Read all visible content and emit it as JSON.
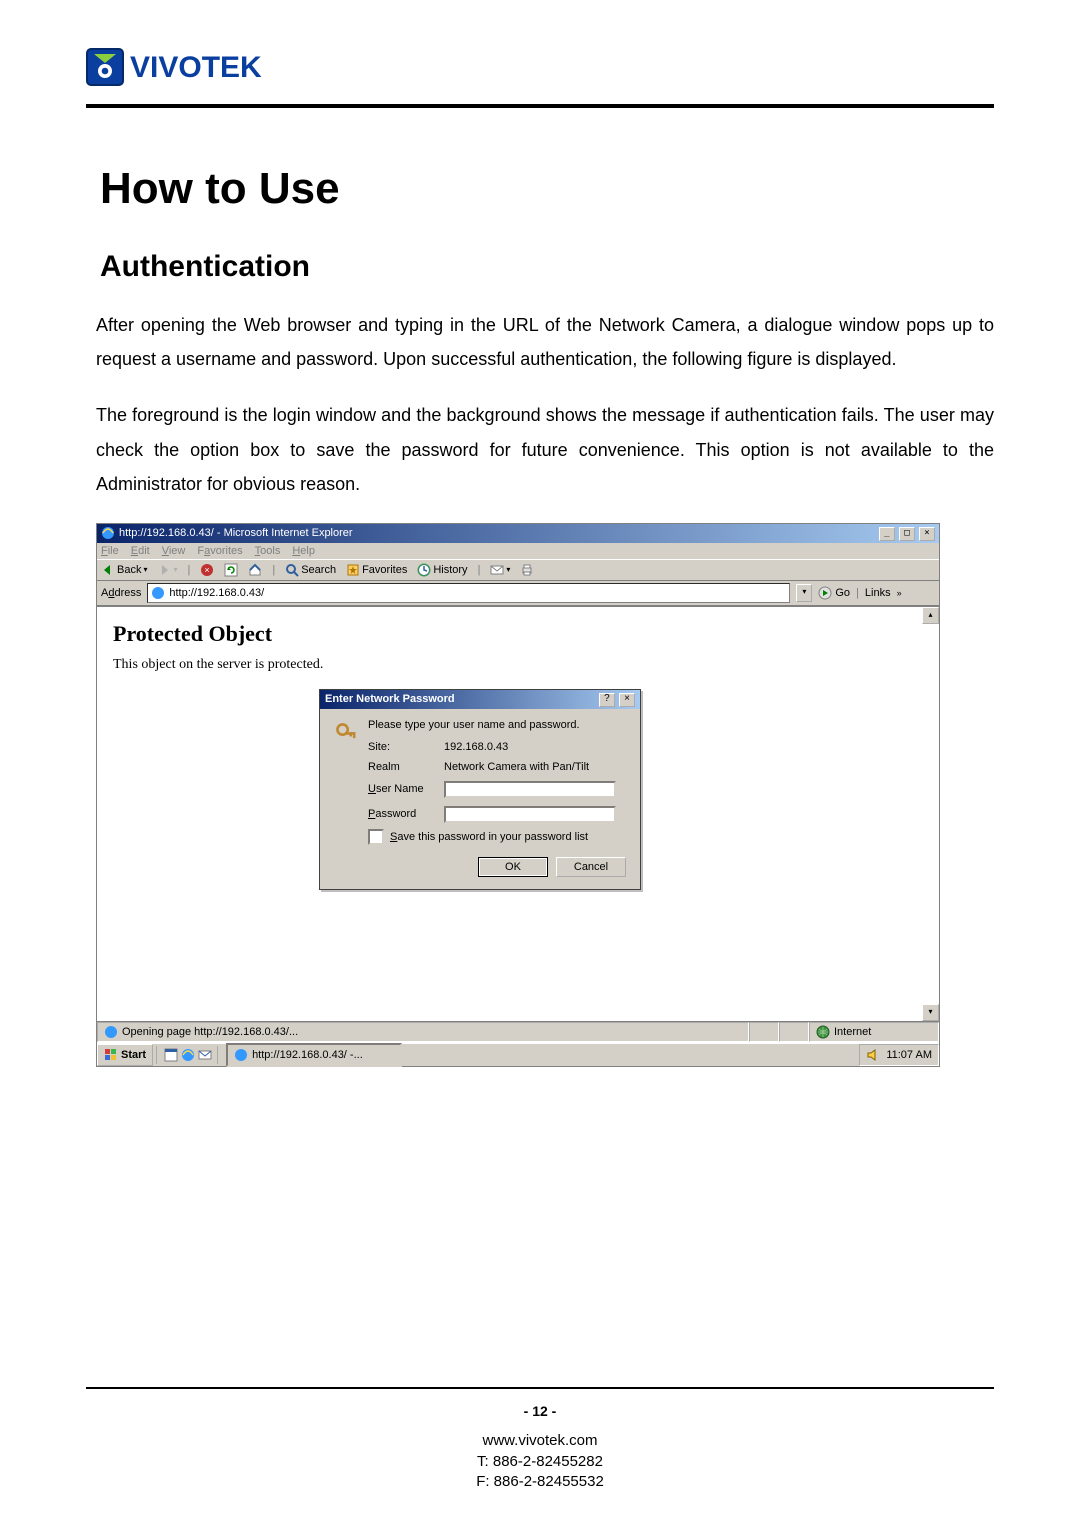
{
  "logo_text": "VIVOTEK",
  "h1": "How to Use",
  "h2": "Authentication",
  "para1": "After opening the Web browser and typing in the URL of the Network Camera, a dialogue window pops up to request a username and password. Upon successful authentication, the following figure is displayed.",
  "para2": "The foreground is the login window and the background shows the message if authentication fails. The user may check the option box to save the password for future convenience.  This option is not available to the Administrator for obvious reason.",
  "ie": {
    "title": "http://192.168.0.43/ - Microsoft Internet Explorer",
    "menu": {
      "file": "File",
      "edit": "Edit",
      "view": "View",
      "favorites": "Favorites",
      "tools": "Tools",
      "help": "Help"
    },
    "tb": {
      "back": "Back",
      "search": "Search",
      "favorites": "Favorites",
      "history": "History"
    },
    "addr_label": "Address",
    "addr_value": "http://192.168.0.43/",
    "go": "Go",
    "links": "Links",
    "content": {
      "heading": "Protected Object",
      "line": "This object on the server is protected."
    },
    "status_main": "Opening page http://192.168.0.43/...",
    "status_zone": "Internet",
    "taskbar": {
      "start": "Start",
      "task": "http://192.168.0.43/ -...",
      "clock": "11:07 AM"
    }
  },
  "dialog": {
    "title": "Enter Network Password",
    "prompt": "Please type your user name and password.",
    "site_label": "Site:",
    "site_value": "192.168.0.43",
    "realm_label": "Realm",
    "realm_value": "Network Camera with Pan/Tilt",
    "user_label": "User Name",
    "pass_label": "Password",
    "save_label": "Save this password in your password list",
    "ok": "OK",
    "cancel": "Cancel"
  },
  "footer": {
    "page": "- 12 -",
    "site": "www.vivotek.com",
    "tel": "T: 886-2-82455282",
    "fax": "F: 886-2-82455532"
  }
}
